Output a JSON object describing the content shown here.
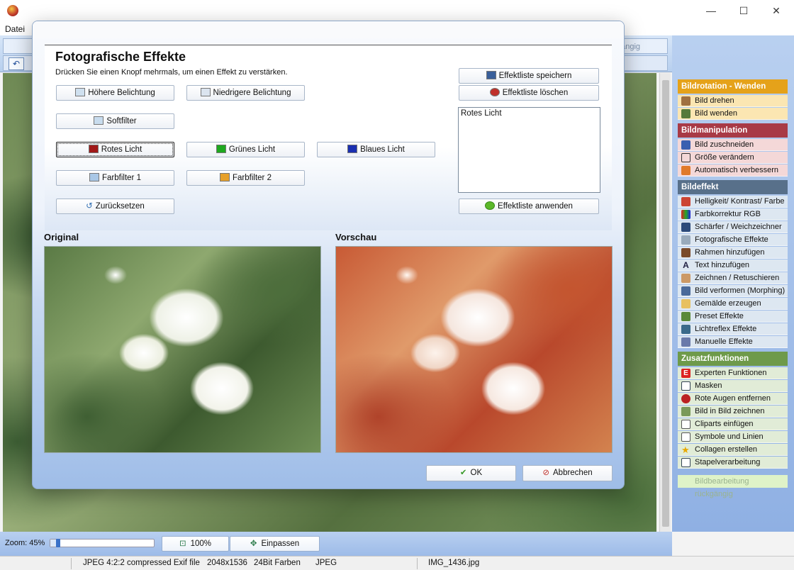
{
  "menu": {
    "file": "Datei"
  },
  "toolbar": {
    "undo_ghost": "gängig"
  },
  "window_controls": {
    "minimize": "—",
    "maximize": "☐",
    "close": "✕"
  },
  "dialog": {
    "title": "Fotografische Effekte",
    "subtitle": "Drücken Sie einen Knopf mehrmals, um einen Effekt zu verstärken.",
    "buttons": {
      "higher_exposure": "Höhere Belichtung",
      "lower_exposure": "Niedrigere Belichtung",
      "softfilter": "Softfilter",
      "red_light": "Rotes Licht",
      "green_light": "Grünes Licht",
      "blue_light": "Blaues Licht",
      "colorfilter1": "Farbfilter 1",
      "colorfilter2": "Farbfilter 2",
      "reset": "Zurücksetzen",
      "save_list": "Effektliste speichern",
      "delete_list": "Effektliste löschen",
      "apply_list": "Effektliste anwenden",
      "ok": "OK",
      "cancel": "Abbrechen"
    },
    "effect_list": [
      "Rotes Licht"
    ],
    "original_label": "Original",
    "preview_label": "Vorschau"
  },
  "sidebar": {
    "cat1": "Bildrotation - Wenden",
    "cat1_items": [
      "Bild drehen",
      "Bild wenden"
    ],
    "cat2": "Bildmanipulation",
    "cat2_items": [
      "Bild zuschneiden",
      "Größe verändern",
      "Automatisch verbessern"
    ],
    "cat3": "Bildeffekt",
    "cat3_items": [
      "Helligkeit/ Kontrast/ Farbe",
      "Farbkorrektur RGB",
      "Schärfer / Weichzeichner",
      "Fotografische Effekte",
      "Rahmen hinzufügen",
      "Text hinzufügen",
      "Zeichnen / Retuschieren",
      "Bild verformen (Morphing)",
      "Gemälde erzeugen",
      "Preset Effekte",
      "Lichtreflex Effekte",
      "Manuelle Effekte"
    ],
    "cat4": "Zusatzfunktionen",
    "cat4_items": [
      "Experten Funktionen",
      "Masken",
      "Rote Augen entfernen",
      "Bild in Bild zeichnen",
      "Cliparts einfügen",
      "Symbole und Linien",
      "Collagen erstellen",
      "Stapelverarbeitung"
    ],
    "undo": "Bildbearbeitung rückgängig"
  },
  "bottom": {
    "zoom_label": "Zoom: 45%",
    "zoom_value": 0.45,
    "btn_100": "100%",
    "btn_fit": "Einpassen"
  },
  "status": {
    "format": "JPEG 4:2:2 compressed Exif file",
    "size": "2048x1536",
    "colors": "24Bit Farben",
    "type": "JPEG",
    "filename": "IMG_1436.jpg"
  },
  "colors": {
    "cat1": "#e5a21a",
    "cat2": "#a83a46",
    "cat3": "#58708a",
    "cat4": "#6e9a4a",
    "accent": "#3a72c8"
  }
}
